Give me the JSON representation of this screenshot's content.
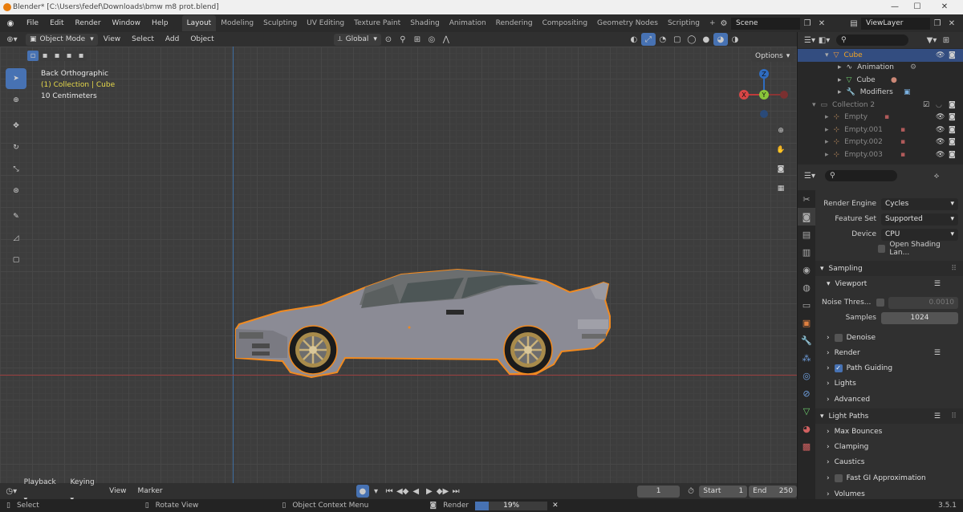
{
  "window": {
    "title": "Blender* [C:\\Users\\fedef\\Downloads\\bmw m8 prot.blend]",
    "min": "—",
    "max": "☐",
    "close": "✕"
  },
  "menu": [
    "File",
    "Edit",
    "Render",
    "Window",
    "Help"
  ],
  "workspaces": [
    "Layout",
    "Modeling",
    "Sculpting",
    "UV Editing",
    "Texture Paint",
    "Shading",
    "Animation",
    "Rendering",
    "Compositing",
    "Geometry Nodes",
    "Scripting"
  ],
  "workspace_add": "+",
  "scene": "Scene",
  "viewlayer": "ViewLayer",
  "viewport_header": {
    "mode": "Object Mode",
    "menus": [
      "View",
      "Select",
      "Add",
      "Object"
    ],
    "transform": "Global",
    "options": "Options"
  },
  "overlay": {
    "view": "Back Orthographic",
    "collection": "(1) Collection | Cube",
    "scale": "10 Centimeters"
  },
  "gizmo": {
    "z": "Z",
    "x": "X",
    "y": "Y"
  },
  "outliner": {
    "rows": [
      {
        "name": "Cube",
        "selected": true
      },
      {
        "name": "Animation"
      },
      {
        "name": "Cube"
      },
      {
        "name": "Modifiers"
      },
      {
        "name": "Collection 2"
      },
      {
        "name": "Empty"
      },
      {
        "name": "Empty.001"
      },
      {
        "name": "Empty.002"
      },
      {
        "name": "Empty.003"
      }
    ]
  },
  "props": {
    "render_engine_label": "Render Engine",
    "render_engine": "Cycles",
    "feature_set_label": "Feature Set",
    "feature_set": "Supported",
    "device_label": "Device",
    "device": "CPU",
    "osl": "Open Shading Lan...",
    "sampling": "Sampling",
    "viewport": "Viewport",
    "noise_label": "Noise Thres...",
    "noise_value": "0.0010",
    "samples_label": "Samples",
    "samples_value": "1024",
    "denoise": "Denoise",
    "render": "Render",
    "path_guiding": "Path Guiding",
    "lights": "Lights",
    "advanced": "Advanced",
    "light_paths": "Light Paths",
    "max_bounces": "Max Bounces",
    "clamping": "Clamping",
    "caustics": "Caustics",
    "fast_gi": "Fast GI Approximation",
    "volumes": "Volumes"
  },
  "timeline": {
    "playback": "Playback",
    "keying": "Keying",
    "view": "View",
    "marker": "Marker",
    "frame": "1",
    "start_label": "Start",
    "start": "1",
    "end_label": "End",
    "end": "250"
  },
  "status": {
    "select": "Select",
    "rotate": "Rotate View",
    "context": "Object Context Menu",
    "render": "Render",
    "progress": 0.19,
    "progress_text": "19%",
    "version": "3.5.1"
  }
}
